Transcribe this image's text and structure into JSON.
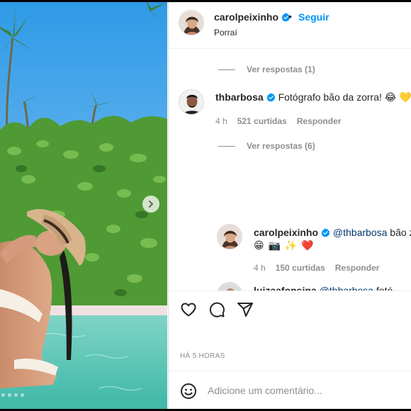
{
  "post": {
    "author": "carolpeixinho",
    "separator": "•",
    "follow_label": "Seguir",
    "location": "Porraí"
  },
  "comments": {
    "view_replies_1": "Ver respostas (1)",
    "comment1": {
      "user": "thbarbosa",
      "text": "Fotógrafo bão da zorra! 😂 💛",
      "time": "4 h",
      "likes": "521 curtidas",
      "reply": "Responder"
    },
    "view_replies_2": "Ver respostas (6)",
    "reply1": {
      "user": "carolpeixinho",
      "mention": "@thbarbosa",
      "text_after": "bão zã",
      "line2": "😁 📷 ✨ ❤️",
      "time": "4 h",
      "likes": "150 curtidas",
      "reply": "Responder"
    },
    "reply2_partial": {
      "user": "luizaafonsina",
      "mention": "@thbarbosa",
      "text_after": "fotó"
    }
  },
  "footer": {
    "time_ago": "HÁ 5 HORAS",
    "comment_placeholder": "Adicione um comentário..."
  },
  "icons": {
    "like": "heart-icon",
    "comment": "comment-icon",
    "share": "share-icon",
    "emoji": "emoji-icon",
    "next": "chevron-right-icon",
    "verified": "verified-badge-icon"
  },
  "colors": {
    "accent": "#0095f6",
    "verified": "#0095f6",
    "text": "#262626",
    "muted": "#8e8e8e",
    "mention": "#00376b"
  }
}
